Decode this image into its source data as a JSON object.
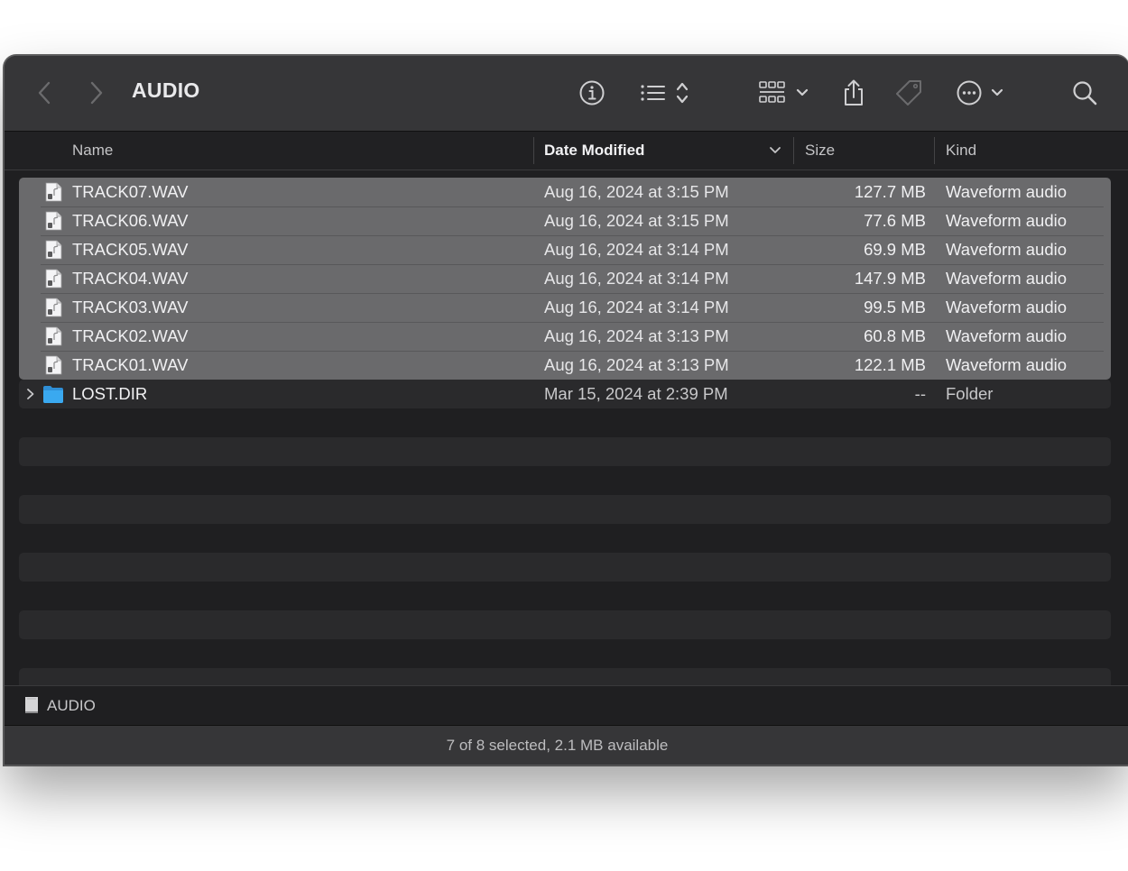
{
  "window": {
    "title": "AUDIO"
  },
  "toolbar": {
    "back_icon": "chevron-left-icon",
    "forward_icon": "chevron-right-icon",
    "info_icon": "info-circle-icon",
    "list_view_icon": "list-view-icon",
    "group_icon": "grid-group-icon",
    "share_icon": "share-icon",
    "tag_icon": "tag-icon",
    "more_icon": "ellipsis-circle-icon",
    "search_icon": "search-icon"
  },
  "columns": {
    "name": "Name",
    "date": "Date Modified",
    "size": "Size",
    "kind": "Kind"
  },
  "files": [
    {
      "name": "TRACK07.WAV",
      "date": "Aug 16, 2024 at 3:15 PM",
      "size": "127.7 MB",
      "kind": "Waveform audio",
      "selected": true,
      "icon": "audio-file-icon"
    },
    {
      "name": "TRACK06.WAV",
      "date": "Aug 16, 2024 at 3:15 PM",
      "size": "77.6 MB",
      "kind": "Waveform audio",
      "selected": true,
      "icon": "audio-file-icon"
    },
    {
      "name": "TRACK05.WAV",
      "date": "Aug 16, 2024 at 3:14 PM",
      "size": "69.9 MB",
      "kind": "Waveform audio",
      "selected": true,
      "icon": "audio-file-icon"
    },
    {
      "name": "TRACK04.WAV",
      "date": "Aug 16, 2024 at 3:14 PM",
      "size": "147.9 MB",
      "kind": "Waveform audio",
      "selected": true,
      "icon": "audio-file-icon"
    },
    {
      "name": "TRACK03.WAV",
      "date": "Aug 16, 2024 at 3:14 PM",
      "size": "99.5 MB",
      "kind": "Waveform audio",
      "selected": true,
      "icon": "audio-file-icon"
    },
    {
      "name": "TRACK02.WAV",
      "date": "Aug 16, 2024 at 3:13 PM",
      "size": "60.8 MB",
      "kind": "Waveform audio",
      "selected": true,
      "icon": "audio-file-icon"
    },
    {
      "name": "TRACK01.WAV",
      "date": "Aug 16, 2024 at 3:13 PM",
      "size": "122.1 MB",
      "kind": "Waveform audio",
      "selected": true,
      "icon": "audio-file-icon"
    },
    {
      "name": "LOST.DIR",
      "date": "Mar 15, 2024 at 2:39 PM",
      "size": "--",
      "kind": "Folder",
      "selected": false,
      "icon": "folder-icon"
    }
  ],
  "pathbar": {
    "label": "AUDIO",
    "icon": "drive-icon"
  },
  "status": {
    "text": "7 of 8 selected, 2.1 MB available"
  },
  "colors": {
    "window_bg": "#1f1f21",
    "toolbar_bg": "#363638",
    "selection": "#6a6a6c",
    "folder_blue": "#3aa9f0"
  }
}
